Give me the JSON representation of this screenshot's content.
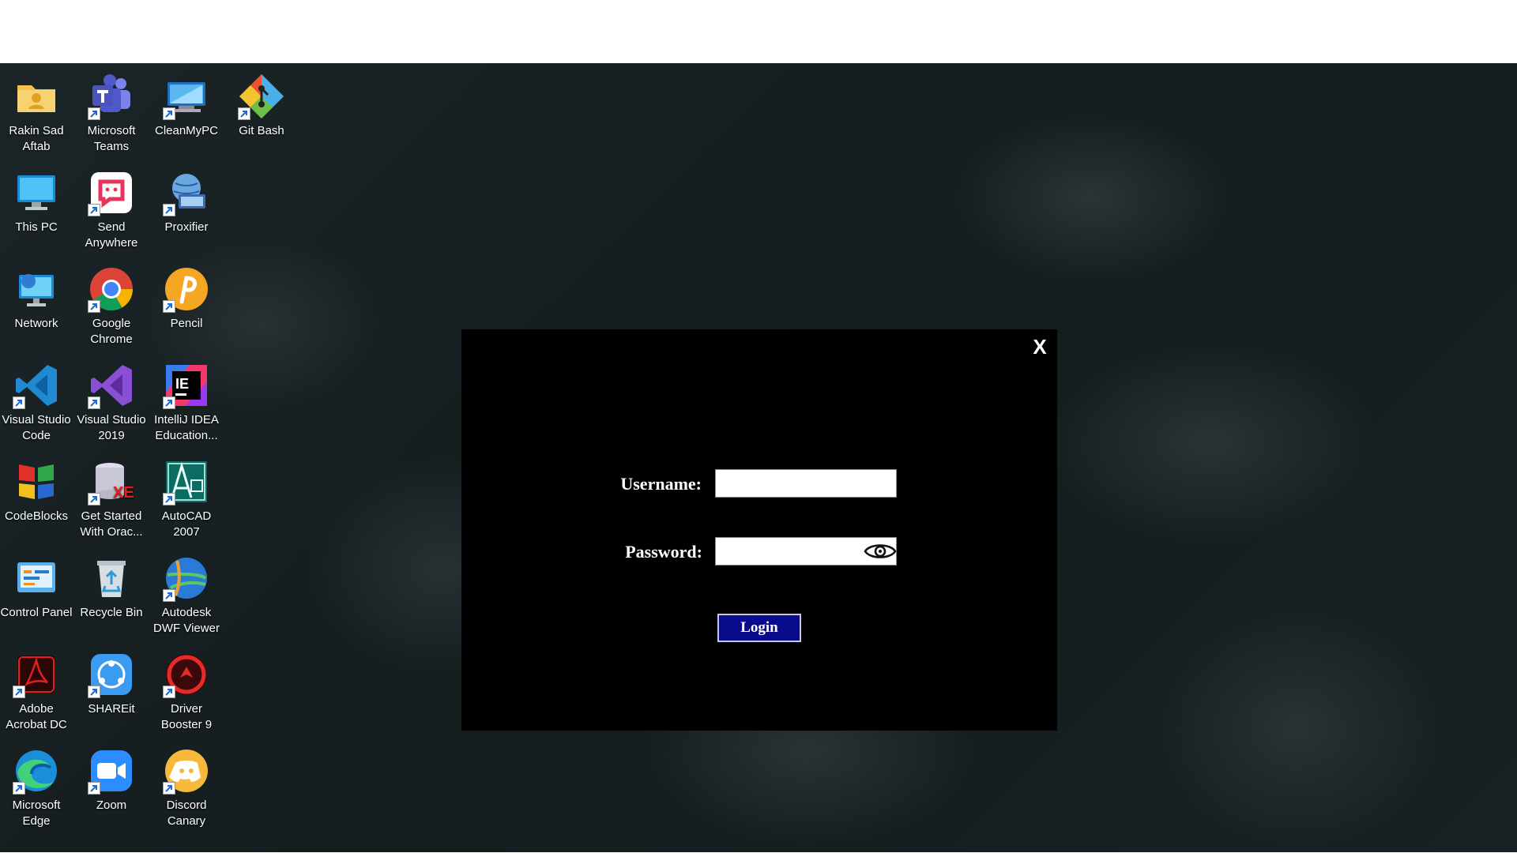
{
  "desktop": {
    "icons": [
      {
        "label": "Rakin Sad\nAftab",
        "icon": "user-folder-icon",
        "shortcut": false
      },
      {
        "label": "Microsoft\nTeams",
        "icon": "teams-icon",
        "shortcut": true
      },
      {
        "label": "CleanMyPC",
        "icon": "cleanmypc-icon",
        "shortcut": true
      },
      {
        "label": "Git Bash",
        "icon": "git-bash-icon",
        "shortcut": true
      },
      {
        "label": "This PC",
        "icon": "computer-icon",
        "shortcut": false
      },
      {
        "label": "Send\nAnywhere",
        "icon": "send-anywhere-icon",
        "shortcut": true
      },
      {
        "label": "Proxifier",
        "icon": "proxifier-icon",
        "shortcut": true
      },
      {
        "label": "Network",
        "icon": "network-icon",
        "shortcut": false
      },
      {
        "label": "Google\nChrome",
        "icon": "chrome-icon",
        "shortcut": true
      },
      {
        "label": "Pencil",
        "icon": "pencil-app-icon",
        "shortcut": true
      },
      {
        "label": "Visual Studio\nCode",
        "icon": "vscode-icon",
        "shortcut": true
      },
      {
        "label": "Visual Studio\n2019",
        "icon": "visual-studio-icon",
        "shortcut": true
      },
      {
        "label": "IntelliJ IDEA\nEducation...",
        "icon": "intellij-icon",
        "shortcut": true
      },
      {
        "label": "CodeBlocks",
        "icon": "codeblocks-icon",
        "shortcut": false
      },
      {
        "label": "Get Started\nWith Orac...",
        "icon": "oracle-xe-icon",
        "shortcut": true
      },
      {
        "label": "AutoCAD\n2007",
        "icon": "autocad-icon",
        "shortcut": true
      },
      {
        "label": "Control Panel",
        "icon": "control-panel-icon",
        "shortcut": false
      },
      {
        "label": "Recycle Bin",
        "icon": "recycle-bin-icon",
        "shortcut": false
      },
      {
        "label": "Autodesk\nDWF Viewer",
        "icon": "dwf-viewer-icon",
        "shortcut": true
      },
      {
        "label": "Adobe\nAcrobat DC",
        "icon": "acrobat-icon",
        "shortcut": true
      },
      {
        "label": "SHAREit",
        "icon": "shareit-icon",
        "shortcut": true
      },
      {
        "label": "Driver\nBooster 9",
        "icon": "driver-booster-icon",
        "shortcut": true
      },
      {
        "label": "Microsoft\nEdge",
        "icon": "edge-icon",
        "shortcut": true
      },
      {
        "label": "Zoom",
        "icon": "zoom-icon",
        "shortcut": true
      },
      {
        "label": "Discord\nCanary",
        "icon": "discord-icon",
        "shortcut": true
      }
    ]
  },
  "login": {
    "close_label": "X",
    "username_label": "Username:",
    "username_value": "",
    "password_label": "Password:",
    "password_value": "",
    "show_password_icon": "eye-icon",
    "login_label": "Login"
  },
  "colors": {
    "dialog_bg": "#000000",
    "login_button_bg": "#0a0a8c",
    "desktop_bg": "#182124"
  }
}
